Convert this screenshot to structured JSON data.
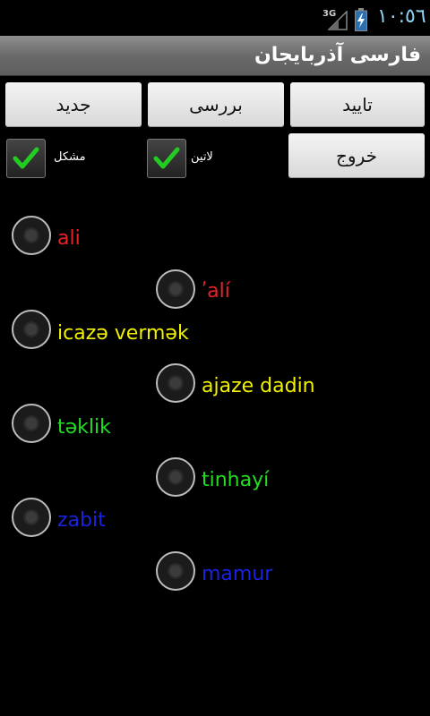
{
  "status_bar": {
    "network": "3G",
    "time": "١٠:٥٦",
    "clock_color": "#8fd3f5"
  },
  "title_bar": {
    "title": "فارسی آذربایجان"
  },
  "buttons": {
    "new": "جدید",
    "check": "بررسی",
    "confirm": "تایید",
    "exit": "خروج"
  },
  "checkboxes": {
    "hard": {
      "label": "مشکل",
      "checked": true
    },
    "latin": {
      "label": "لاتین",
      "checked": true
    },
    "check_color": "#22cc22"
  },
  "options": [
    {
      "text": "ali",
      "color": "#e8212b"
    },
    {
      "text": "ʹalí",
      "color": "#e8212b"
    },
    {
      "text": "icazə vermək",
      "color": "#f0f000"
    },
    {
      "text": "ajaze dadin",
      "color": "#f0f000"
    },
    {
      "text": "təklik",
      "color": "#22dd22"
    },
    {
      "text": "tinhayí",
      "color": "#22dd22"
    },
    {
      "text": "zabit",
      "color": "#1a22e0"
    },
    {
      "text": "mamur",
      "color": "#1a22e0"
    }
  ]
}
